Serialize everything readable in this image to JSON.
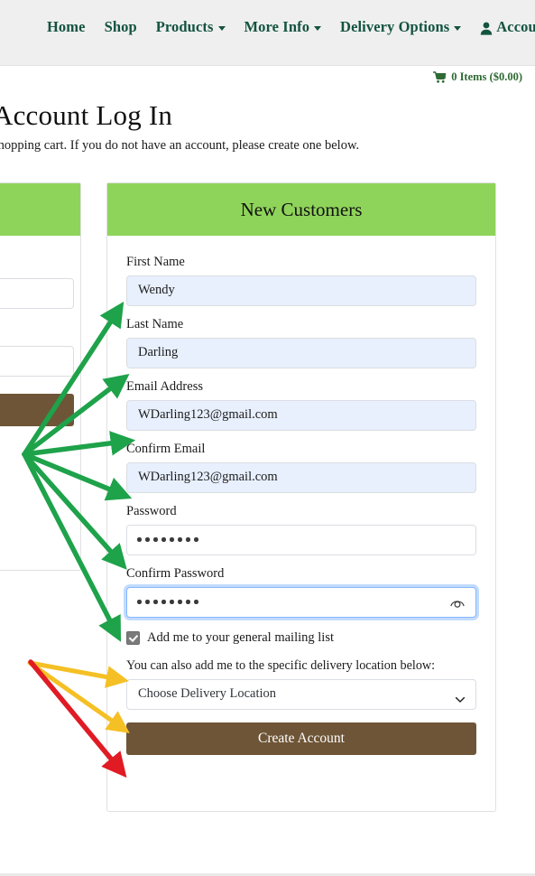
{
  "nav": {
    "items": [
      {
        "label": "Home",
        "has_caret": false,
        "icon": null
      },
      {
        "label": "Shop",
        "has_caret": false,
        "icon": null
      },
      {
        "label": "Products",
        "has_caret": true,
        "icon": null
      },
      {
        "label": "More Info",
        "has_caret": true,
        "icon": null
      },
      {
        "label": "Delivery Options",
        "has_caret": true,
        "icon": null
      },
      {
        "label": "Account",
        "has_caret": true,
        "icon": "person-icon"
      }
    ]
  },
  "cart": {
    "icon": "shopping-cart-icon",
    "label": "0 Items ($0.00)",
    "item_count": 0,
    "total": "$0.00"
  },
  "page": {
    "title": "Account Log In",
    "subtitle": "shopping cart. If you do not have an account, please create one below."
  },
  "left_card": {
    "header": "",
    "note": "partially visible existing-customer login card, clipped by horizontal scroll"
  },
  "new_customers": {
    "header": "New Customers",
    "fields": [
      {
        "label": "First Name",
        "value": "Wendy",
        "type": "text",
        "autofilled": true,
        "focused": false
      },
      {
        "label": "Last Name",
        "value": "Darling",
        "type": "text",
        "autofilled": true,
        "focused": false
      },
      {
        "label": "Email Address",
        "value": "WDarling123@gmail.com",
        "type": "email",
        "autofilled": true,
        "focused": false
      },
      {
        "label": "Confirm Email",
        "value": "WDarling123@gmail.com",
        "type": "email",
        "autofilled": true,
        "focused": false
      },
      {
        "label": "Password",
        "value": "••••••••",
        "type": "password",
        "autofilled": false,
        "focused": false,
        "dots": 8
      },
      {
        "label": "Confirm Password",
        "value": "••••••••",
        "type": "password",
        "autofilled": false,
        "focused": true,
        "dots": 8,
        "reveal_icon": "eye-icon"
      }
    ],
    "mailing_list": {
      "label": "Add me to your general mailing list",
      "checked": true
    },
    "delivery": {
      "note": "You can also add me to the specific delivery location below:",
      "selected": "Choose Delivery Location"
    },
    "submit_label": "Create Account"
  },
  "annotations": {
    "green": {
      "color": "#1EA24A",
      "count": 6,
      "targets": [
        "First Name input",
        "Last Name input",
        "Email Address input",
        "Confirm Email input",
        "Password input",
        "Confirm Password input"
      ]
    },
    "yellow": {
      "color": "#F5C025",
      "count": 2,
      "targets": [
        "mailing list checkbox",
        "delivery location dropdown"
      ]
    },
    "red": {
      "color": "#E01B24",
      "count": 1,
      "targets": [
        "Create Account button"
      ]
    }
  },
  "colors": {
    "nav_text": "#13533f",
    "nav_bg": "#efefef",
    "card_header_green": "#8FD45A",
    "button_brown": "#6E5537",
    "autofill_blue": "#E8F0FE",
    "focus_blue": "#86b7fe",
    "cart_green": "#2e6b33"
  }
}
